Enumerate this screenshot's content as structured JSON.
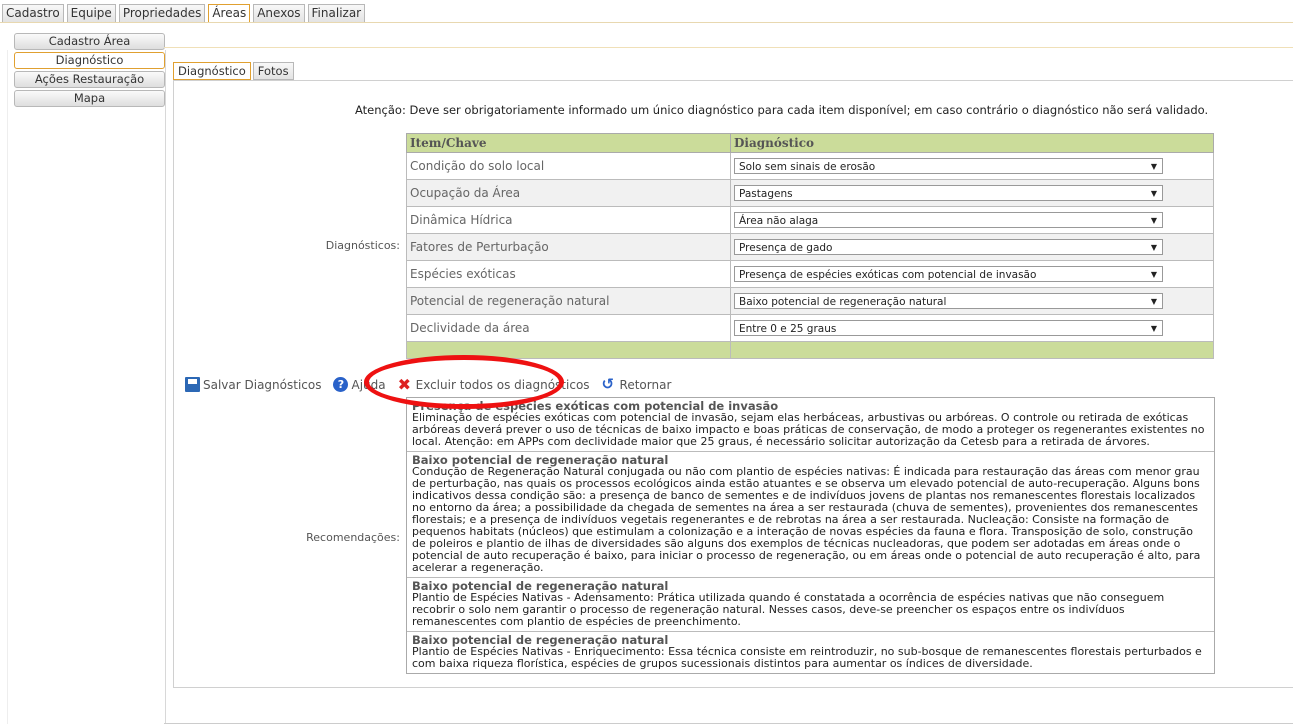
{
  "top_tabs": [
    "Cadastro",
    "Equipe",
    "Propriedades",
    "Áreas",
    "Anexos",
    "Finalizar"
  ],
  "sidebar": [
    "Cadastro Área",
    "Diagnóstico",
    "Ações Restauração",
    "Mapa"
  ],
  "sub_tabs": [
    "Diagnóstico",
    "Fotos"
  ],
  "attention": {
    "label": "Atenção:",
    "text": "Deve ser obrigatoriamente informado um único diagnóstico para cada item disponível; em caso contrário o diagnóstico não será validado."
  },
  "diagnosticos_label": "Diagnósticos:",
  "recomendacoes_label": "Recomendações:",
  "table": {
    "headers": [
      "Item/Chave",
      "Diagnóstico"
    ],
    "rows": [
      {
        "item": "Condição do solo local",
        "value": "Solo sem sinais de erosão"
      },
      {
        "item": "Ocupação da Área",
        "value": "Pastagens"
      },
      {
        "item": "Dinâmica Hídrica",
        "value": "Área não alaga"
      },
      {
        "item": "Fatores de Perturbação",
        "value": "Presença de gado"
      },
      {
        "item": "Espécies exóticas",
        "value": "Presença de espécies exóticas com potencial de invasão"
      },
      {
        "item": "Potencial de regeneração natural",
        "value": "Baixo potencial de regeneração natural"
      },
      {
        "item": "Declividade da área",
        "value": "Entre 0 e 25 graus"
      }
    ]
  },
  "actions": {
    "save": "Salvar Diagnósticos",
    "help": "Ajuda",
    "delete": "Excluir todos os diagnósticos",
    "back": "Retornar"
  },
  "recommendations": [
    {
      "title": "Presença de espécies exóticas com potencial de invasão",
      "text": "Eliminação de espécies exóticas com potencial de invasão, sejam elas herbáceas, arbustivas ou arbóreas. O controle ou retirada de exóticas arbóreas deverá prever o uso de técnicas de baixo impacto e boas práticas de conservação, de modo a proteger os regenerantes existentes no local. Atenção: em APPs com declividade maior que 25 graus, é necessário solicitar autorização da Cetesb para a retirada de árvores."
    },
    {
      "title": "Baixo potencial de regeneração natural",
      "text": "Condução de Regeneração Natural conjugada ou não com plantio de espécies nativas: É indicada para restauração das áreas com menor grau de perturbação, nas quais os processos ecológicos ainda estão atuantes e se observa um elevado potencial de auto-recuperação. Alguns bons indicativos dessa condição são: a presença de banco de sementes e de indivíduos jovens de plantas nos remanescentes florestais localizados no entorno da área; a possibilidade da chegada de sementes na área a ser restaurada (chuva de sementes), provenientes dos remanescentes florestais; e a presença de indivíduos vegetais regenerantes e de rebrotas na área a ser restaurada. Nucleação: Consiste na formação de pequenos habitats (núcleos) que estimulam a colonização e a interação de novas espécies da fauna e flora. Transposição de solo, construção de poleiros e plantio de ilhas de diversidades são alguns dos exemplos de técnicas nucleadoras, que podem ser adotadas em áreas onde o potencial de auto recuperação é baixo, para iniciar o processo de regeneração, ou em áreas onde o potencial de auto recuperação é alto, para acelerar a regeneração."
    },
    {
      "title": "Baixo potencial de regeneração natural",
      "text": "Plantio de Espécies Nativas - Adensamento: Prática utilizada quando é constatada a ocorrência de espécies nativas que não conseguem recobrir o solo nem garantir o processo de regeneração natural. Nesses casos, deve-se preencher os espaços entre os indivíduos remanescentes com plantio de espécies de preenchimento."
    },
    {
      "title": "Baixo potencial de regeneração natural",
      "text": "Plantio de Espécies Nativas - Enriquecimento: Essa técnica consiste em reintroduzir, no sub-bosque de remanescentes florestais perturbados e com baixa riqueza florística, espécies de grupos sucessionais distintos para aumentar os índices de diversidade."
    }
  ],
  "colors": {
    "header_green": "#cbdc9a",
    "active_tab_border": "#e0a030",
    "highlight_oval": "#e11111"
  },
  "icons": [
    "save-icon",
    "help-icon",
    "delete-icon",
    "return-icon",
    "dropdown-arrow-icon"
  ]
}
